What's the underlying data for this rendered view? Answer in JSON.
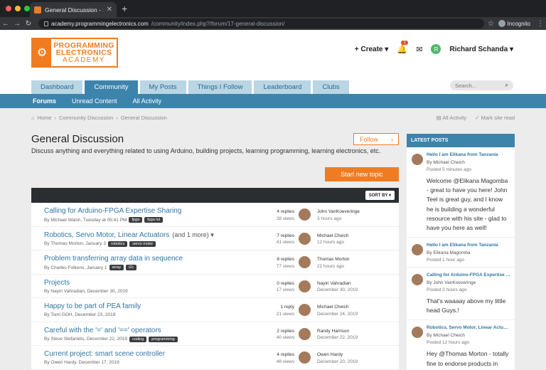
{
  "browser": {
    "tab_title": "General Discussion - Programmi...",
    "url_host": "academy.programmingelectronics.com",
    "url_path": "/community/index.php?/forum/17-general-discussion/",
    "incognito_label": "Incognito",
    "dot_colors": [
      "#ff5f57",
      "#febc2e",
      "#28c840"
    ]
  },
  "site": {
    "logo_line1": "PROGRAMMING",
    "logo_line2": "ELECTRONICS",
    "logo_line3": "ACADEMY",
    "brand_color": "#f07c22",
    "accent_color": "#3d84ad"
  },
  "userbar": {
    "create_label": "Create",
    "notification_count": "1",
    "avatar_letter": "R",
    "user_name": "Richard Schanda"
  },
  "nav": {
    "tabs": [
      {
        "label": "Dashboard"
      },
      {
        "label": "Community"
      },
      {
        "label": "My Posts"
      },
      {
        "label": "Things I Follow"
      },
      {
        "label": "Leaderboard"
      },
      {
        "label": "Clubs"
      }
    ],
    "search_placeholder": "Search..."
  },
  "subnav": {
    "items": [
      {
        "label": "Forums"
      },
      {
        "label": "Unread Content"
      },
      {
        "label": "All Activity"
      }
    ]
  },
  "breadcrumb": {
    "home": "Home",
    "community": "Community Discussion",
    "current": "General Discussion",
    "all_activity": "All Activity",
    "mark_read": "Mark site read"
  },
  "forum": {
    "title": "General Discussion",
    "description": "Discuss anything and everything related to using Arduino, building projects, learning programming, learning electronics, etc.",
    "follow_label": "Follow",
    "start_topic_label": "Start new topic",
    "sort_label": "SORT BY"
  },
  "topics": [
    {
      "title": "Calling for Arduino-FPGA Expertise Sharing",
      "author": "By Michael Walsh, Tuesday at 05:41 PM",
      "tags": [
        "fpga",
        "fpga lut"
      ],
      "replies": "4 replies",
      "views": "28 views",
      "last_user": "John VanKoeveringe",
      "last_time": "3 hours ago",
      "more": ""
    },
    {
      "title": "Robotics, Servo Motor, Linear Actuators",
      "author": "By Thomas Morton, January 3",
      "tags": [
        "robotics",
        "servo motor"
      ],
      "replies": "7 replies",
      "views": "41 views",
      "last_user": "Michael Cheich",
      "last_time": "12 hours ago",
      "more": "(and 1 more)"
    },
    {
      "title": "Problem transferring array data in sequence",
      "author": "By Charles Folkens, January 1",
      "tags": [
        "array",
        "i2c"
      ],
      "replies": "8 replies",
      "views": "77 views",
      "last_user": "Thomas Morton",
      "last_time": "21 hours ago",
      "more": ""
    },
    {
      "title": "Projects",
      "author": "By Nayiri Vahradian, December 30, 2019",
      "tags": [],
      "replies": "0 replies",
      "views": "17 views",
      "last_user": "Nayiri Vahradian",
      "last_time": "December 30, 2019",
      "more": ""
    },
    {
      "title": "Happy to be part of PEA family",
      "author": "By Tomi GOH, December 23, 2019",
      "tags": [],
      "replies": "1 reply",
      "views": "21 views",
      "last_user": "Michael Cheich",
      "last_time": "December 24, 2019",
      "more": ""
    },
    {
      "title": "Careful with the '=' and '==' operators",
      "author": "By Steve Stefanidis, December 22, 2019",
      "tags": [
        "coding",
        "programming"
      ],
      "replies": "2 replies",
      "views": "40 views",
      "last_user": "Randy Harrison",
      "last_time": "December 22, 2019",
      "more": ""
    },
    {
      "title": "Current project: smart scene controller",
      "author": "By Owen Hardy, December 17, 2019",
      "tags": [],
      "replies": "4 replies",
      "views": "48 views",
      "last_user": "Owen Hardy",
      "last_time": "December 20, 2019",
      "more": ""
    }
  ],
  "sidebar": {
    "heading": "LATEST POSTS",
    "posts": [
      {
        "title": "Hello I am Elikana from Tanzania",
        "by": "By Michael Cheich",
        "time": "Posted 5 minutes ago",
        "body": "Welcome @Elikana Magomba - great to have you here!  John Teel is great guy, and I know he is building a wonderful resource with his site - glad to have you here as well!"
      },
      {
        "title": "Hello I am Elikana from Tanzania",
        "by": "By Elikana Magomba",
        "time": "Posted 1 hour ago",
        "body": ""
      },
      {
        "title": "Calling for Arduino-FPGA Expertise S...",
        "by": "By John VanKoeveringe",
        "time": "Posted 3 hours ago",
        "body": "That's waaaay above my little head   Guys.!"
      },
      {
        "title": "Robotics, Servo Motor, Linear Actuat...",
        "by": "By Michael Cheich",
        "time": "Posted 12 hours ago",
        "body": "Hey @Thomas Morton - totally fine to endorse products in good will and I think it will be"
      }
    ]
  }
}
